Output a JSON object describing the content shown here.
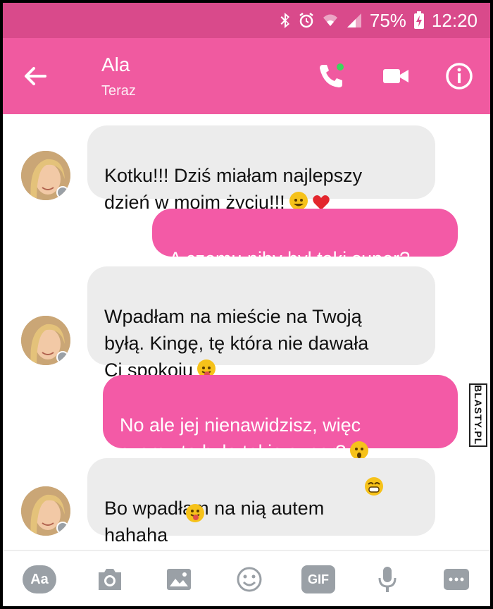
{
  "status": {
    "battery": "75%",
    "time": "12:20"
  },
  "header": {
    "name": "Ala",
    "subtitle": "Teraz",
    "actions": [
      "phone-icon",
      "video-camera-icon",
      "info-icon"
    ]
  },
  "messages": [
    {
      "from": "contact",
      "text": "Kotku!!! Dziś miałam najlepszy\ndzień w moim życiu!!!"
    },
    {
      "from": "me",
      "text": "A czemu niby był taki super?"
    },
    {
      "from": "contact",
      "text": "Wpadłam na mieście na Twoją\nbyłą. Kingę, tę która nie dawała\nCi spokoju"
    },
    {
      "from": "me",
      "text": "No ale jej nienawidzisz, więc\nczemu to było takie super?"
    },
    {
      "from": "contact",
      "text": "Bo wpadłam na nią autem\nhahaha"
    }
  ],
  "composer": {
    "text_button": "Aa",
    "gif_button": "GIF",
    "icons": [
      "camera-icon",
      "image-icon",
      "emoji-icon",
      "microphone-icon",
      "more-icon"
    ]
  },
  "watermark": "BLASTY.PL",
  "colors": {
    "statusbar": "#d94a8b",
    "appbar": "#f05aa0",
    "outgoing_bubble": "#f35aa6",
    "incoming_bubble": "#ececec"
  }
}
